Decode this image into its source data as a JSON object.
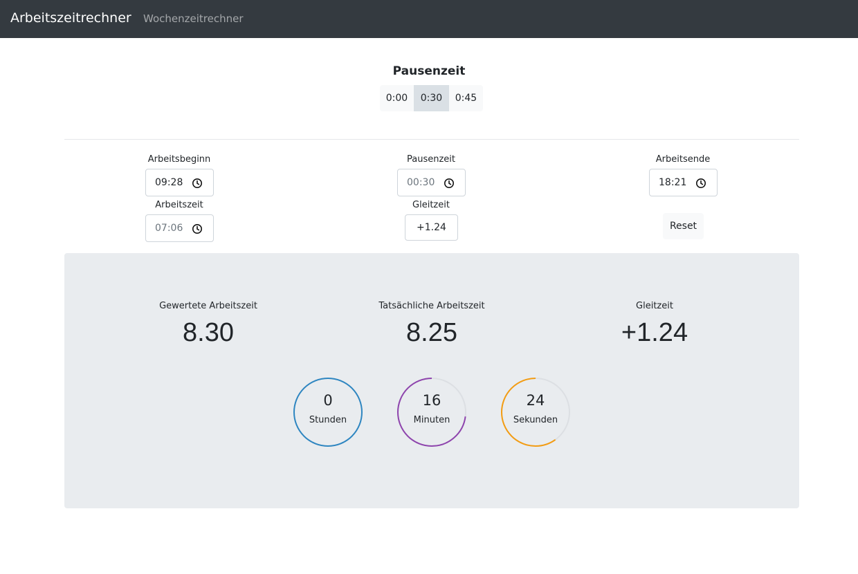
{
  "navbar": {
    "brand": "Arbeitszeitrechner",
    "link": "Wochenzeitrechner"
  },
  "pause_selector": {
    "title": "Pausenzeit",
    "options": [
      "0:00",
      "0:30",
      "0:45"
    ],
    "selected": "0:30"
  },
  "form": {
    "start": {
      "label": "Arbeitsbeginn",
      "value": "09:28"
    },
    "pause": {
      "label": "Pausenzeit",
      "value": "00:30"
    },
    "end": {
      "label": "Arbeitsende",
      "value": "18:21"
    },
    "worktime": {
      "label": "Arbeitszeit",
      "value": "07:06"
    },
    "flextime": {
      "label": "Gleitzeit",
      "value": "+1.24"
    },
    "reset_label": "Reset"
  },
  "results": {
    "weighted": {
      "label": "Gewertete Arbeitszeit",
      "value": "8.30"
    },
    "actual": {
      "label": "Tatsächliche Arbeitszeit",
      "value": "8.25"
    },
    "flextime": {
      "label": "Gleitzeit",
      "value": "+1.24"
    }
  },
  "countdown": [
    {
      "value": "0",
      "unit": "Stunden",
      "fraction": 1.0,
      "color": "#2e86c1"
    },
    {
      "value": "16",
      "unit": "Minuten",
      "fraction": 0.73,
      "color": "#8e44ad"
    },
    {
      "value": "24",
      "unit": "Sekunden",
      "fraction": 0.6,
      "color": "#f39c12"
    }
  ]
}
